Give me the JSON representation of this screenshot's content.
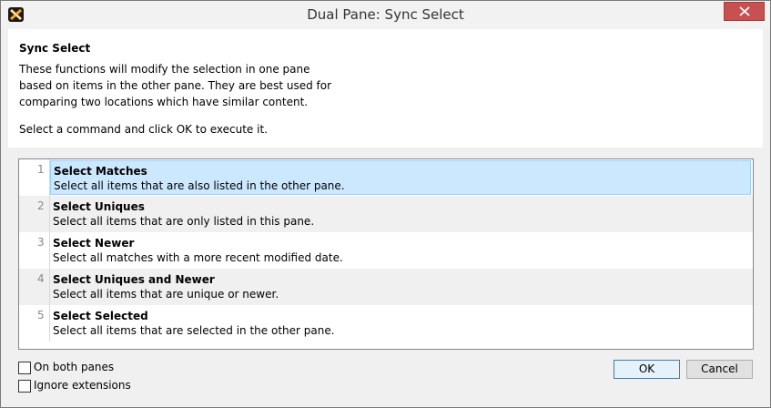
{
  "window": {
    "title": "Dual Pane: Sync Select",
    "close_label": "close"
  },
  "info": {
    "heading": "Sync Select",
    "description": "These functions will modify the selection in one pane based on items in the other pane. They are best used for comparing two locations which have similar content.",
    "instruction": "Select a command and click OK to execute it."
  },
  "commands": [
    {
      "num": "1",
      "title": "Select Matches",
      "desc": "Select all items that are also listed in the other pane."
    },
    {
      "num": "2",
      "title": "Select Uniques",
      "desc": "Select all items that are only listed in this pane."
    },
    {
      "num": "3",
      "title": "Select Newer",
      "desc": "Select all matches with a more recent modified date."
    },
    {
      "num": "4",
      "title": "Select Uniques and Newer",
      "desc": "Select all items that are unique or newer."
    },
    {
      "num": "5",
      "title": "Select Selected",
      "desc": "Select all items that are selected in the other pane."
    }
  ],
  "options": {
    "both_panes": "On both panes",
    "ignore_ext": "Ignore extensions"
  },
  "buttons": {
    "ok": "OK",
    "cancel": "Cancel"
  },
  "colors": {
    "selection": "#cce8ff",
    "close_button": "#c75050"
  }
}
